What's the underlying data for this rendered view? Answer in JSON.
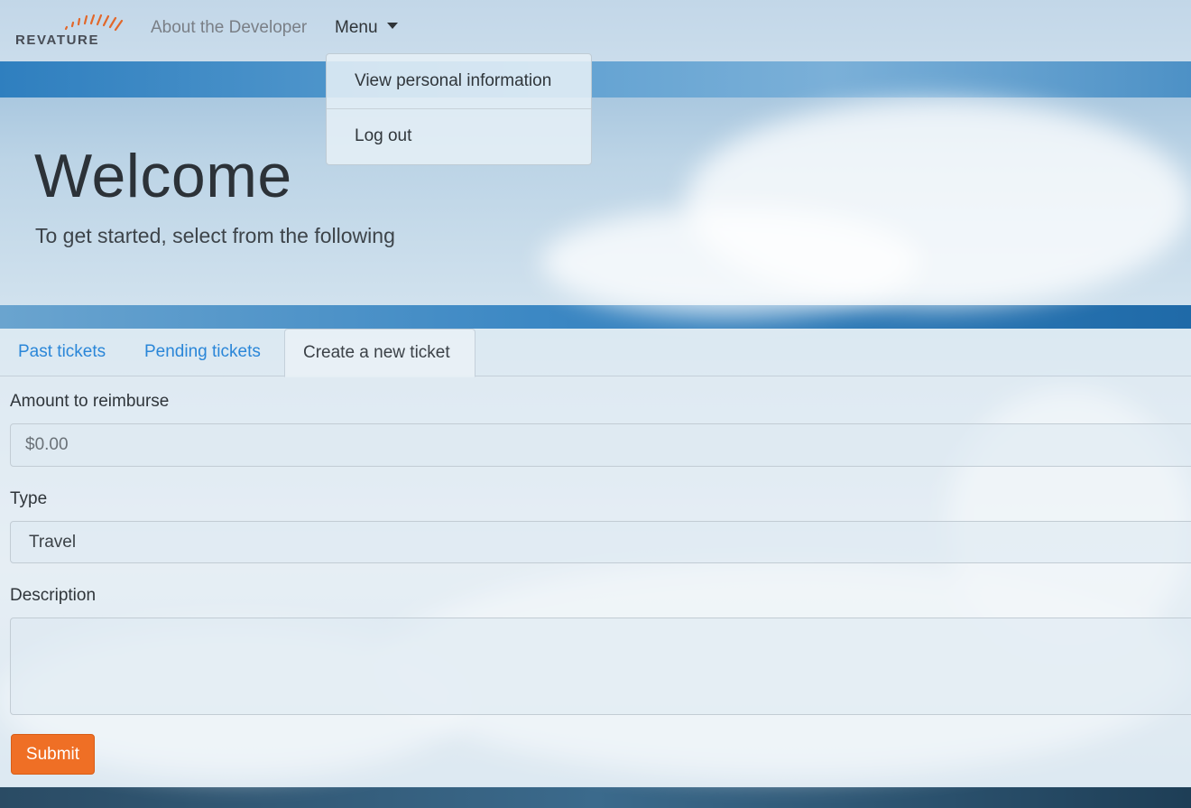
{
  "navbar": {
    "logo_text": "REVATURE",
    "about_label": "About the Developer",
    "menu_label": "Menu",
    "dropdown": {
      "items": [
        {
          "label": "View personal information"
        },
        {
          "label": "Log out"
        }
      ]
    }
  },
  "hero": {
    "title": "Welcome",
    "subtitle": "To get started, select from the following"
  },
  "tabs": [
    {
      "label": "Past tickets"
    },
    {
      "label": "Pending tickets"
    },
    {
      "label": "Create a new ticket",
      "active": true
    }
  ],
  "form": {
    "amount_label": "Amount to reimburse",
    "amount_placeholder": "$0.00",
    "type_label": "Type",
    "type_value": "Travel",
    "description_label": "Description",
    "description_value": "",
    "submit_label": "Submit"
  },
  "colors": {
    "accent": "#ef6f25",
    "tab_link": "#2a86d8",
    "logo_arc": "#e2672a"
  }
}
